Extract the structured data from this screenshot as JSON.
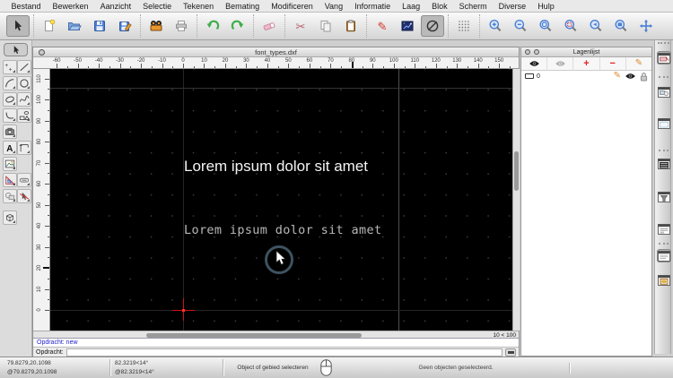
{
  "app": {
    "menus": [
      "Bestand",
      "Bewerken",
      "Aanzicht",
      "Selectie",
      "Tekenen",
      "Bemating",
      "Modificeren",
      "Vang",
      "Informatie",
      "Laag",
      "Blok",
      "Scherm",
      "Diverse",
      "Hulp"
    ]
  },
  "toolbar": {
    "groups": [
      [
        "select-cursor"
      ],
      [
        "new-document",
        "open-file",
        "save",
        "save-as"
      ],
      [
        "plot-print",
        "page-setup"
      ],
      [
        "undo",
        "redo"
      ],
      [
        "eraser"
      ],
      [
        "cut",
        "copy",
        "paste"
      ],
      [
        "annotate-pencil",
        "preview-dark",
        "no-snap"
      ],
      [
        "grid-toggle"
      ],
      [
        "zoom-in",
        "zoom-out",
        "zoom-extents",
        "zoom-window",
        "zoom-previous",
        "zoom-selection",
        "pan"
      ]
    ],
    "selected": [
      "select-cursor",
      "no-snap"
    ]
  },
  "tool_palette": {
    "select_tool": "select-cursor",
    "rows": [
      [
        "points",
        "line"
      ],
      [
        "arc",
        "circle"
      ],
      [
        "ellipse",
        "spline"
      ],
      [
        "freehand-curve",
        "shapes"
      ],
      [
        "camera",
        ""
      ],
      [
        "text",
        "dimension"
      ],
      [
        "image",
        ""
      ],
      [
        "set-square",
        "dimension-bar"
      ],
      [
        "copy-attributes",
        "redline-select"
      ]
    ],
    "bottom_tool": "box-3d"
  },
  "document": {
    "title": "font_types.dxf",
    "h_ruler_labels": [
      -60,
      -50,
      -40,
      -30,
      -20,
      -10,
      0,
      10,
      20,
      30,
      40,
      50,
      60,
      70,
      80,
      90,
      100,
      110,
      120,
      130,
      140,
      150
    ],
    "v_ruler_labels": [
      110,
      100,
      90,
      80,
      70,
      60,
      50,
      40,
      30,
      20,
      10,
      0
    ],
    "canvas": {
      "sans_text": "Lorem ipsum dolor sit amet",
      "cad_text": "Lorem ipsum dolor sit amet"
    },
    "zoom_indicator": "10 < 100",
    "command_history": "Opdracht: new",
    "command_prompt": "Opdracht:"
  },
  "layers_panel": {
    "title": "Lagenlijst",
    "toolbar_icons": [
      "eye-visible-icon",
      "eye-hidden-icon",
      "add-layer-icon",
      "remove-layer-icon",
      "edit-layer-icon"
    ],
    "layers": [
      {
        "name": "0"
      }
    ]
  },
  "right_dock": {
    "buttons": [
      "layer-list-window",
      "copy-style-window",
      "blank-window",
      "dark-list-window",
      "filter-window",
      "detail-list-window",
      "text-window",
      "image-window"
    ],
    "selected": [
      0,
      6
    ]
  },
  "status_bar": {
    "coordinate_absolute": "79.8279,20.1098",
    "coordinate_relative": "@79.8279,20.1098",
    "polar_absolute": "82.3219<14°",
    "polar_relative": "@82.3219<14°",
    "hint": "Object of gebied selecteren",
    "selection_status": "Geen objecten geselecteerd."
  },
  "colors": {
    "canvas_bg": "#000000",
    "accent_blue": "#4a7fd4",
    "accent_red": "#cc2222",
    "snap_ring": "#3e5260",
    "command_text": "#2323cc",
    "cad_text": "#b8b8b8"
  }
}
